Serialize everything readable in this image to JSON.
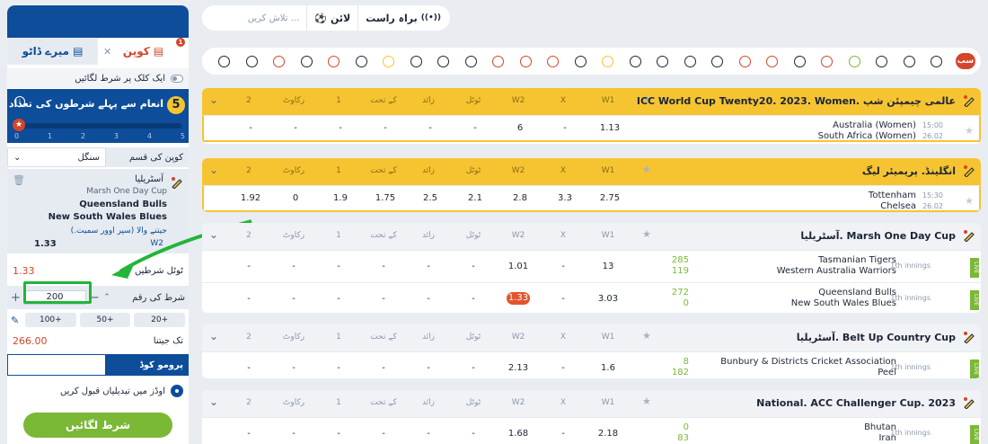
{
  "coupon": {
    "tab_coupon": "کوپن",
    "tab_coupon_count": "1",
    "tab_mydata": "میرے ڈاٹو",
    "one_click": "ایک کلک پر شرط لگائیں",
    "bonus_title": "انعام سے پہلے شرطوں کی تعداد",
    "bonus_count": "5",
    "bonus_ticks": [
      "0",
      "1",
      "2",
      "3",
      "4",
      "5"
    ],
    "bonus_progress": 0,
    "coupon_type_label": "کوپن کی قسم",
    "coupon_type_value": "سنگل",
    "bet": {
      "country": "آسٹریلیا",
      "league": "Marsh One Day Cup",
      "team1": "Queensland Bulls",
      "team2": "New South Wales Blues",
      "market": "جیتنے والا (سپر اوور سمیت.)",
      "pick": "W2",
      "odds": "1.33"
    },
    "total_odds_label": "ٹوٹل شرطیں",
    "total_odds": "1.33",
    "stake_label": "شرط کی رقم",
    "stake_value": "200",
    "quick": [
      "20+",
      "50+",
      "100+"
    ],
    "win_label": "تک جیتنا",
    "win_value": "266.00",
    "promo_label": "پرومو کوڈ",
    "accept_label": "اوڈز میں تبدیلیاں قبول کریں",
    "place_bet": "شرط لگائیں"
  },
  "search": {
    "live_label": "براہ راست",
    "line_label": "لائن",
    "placeholder": "تلاش کریں ..."
  },
  "sports_all": "سب",
  "columns": [
    "W1",
    "X",
    "W2",
    "ٹوٹل",
    "زائد",
    "کے تحت",
    "1",
    "رکاوٹ",
    "2"
  ],
  "leagues": [
    {
      "name": "ICC World Cup Twenty20. 2023. Women. عالمی چیمپئن شپ",
      "style": "yellow",
      "matches": [
        {
          "team1": "Australia (Women)",
          "team2": "South Africa (Women)",
          "time": "15:00",
          "date": "26.02",
          "odds": [
            "1.13",
            "-",
            "6",
            "-",
            "-",
            "-",
            "-",
            "-",
            "-"
          ]
        }
      ]
    },
    {
      "name": "انگلینڈ. پریمیئر لیگ",
      "style": "yellow",
      "matches": [
        {
          "team1": "Tottenham",
          "team2": "Chelsea",
          "time": "15:30",
          "date": "26.02",
          "odds": [
            "2.75",
            "3.3",
            "2.8",
            "2.1",
            "2.5",
            "1.75",
            "1.9",
            "0",
            "1.92"
          ]
        }
      ]
    },
    {
      "name": "آسٹریلیا. Marsh One Day Cup",
      "style": "grey",
      "matches": [
        {
          "team1": "Tasmanian Tigers",
          "team2": "Western Australia Warriors",
          "inning": "1th innings",
          "live": "LIVE",
          "score1": "285",
          "score2": "119",
          "odds": [
            "13",
            "-",
            "1.01",
            "-",
            "-",
            "-",
            "-",
            "-",
            "-"
          ]
        },
        {
          "team1": "Queensland Bulls",
          "team2": "New South Wales Blues",
          "inning": "1th innings",
          "live": "LIVE",
          "score1": "272",
          "score2": "0",
          "odds": [
            "3.03",
            "-",
            "1.33",
            "-",
            "-",
            "-",
            "-",
            "-",
            "-"
          ]
        }
      ]
    },
    {
      "name": "آسٹریلیا. Belt Up Country Cup",
      "style": "grey",
      "matches": [
        {
          "team1": "Bunbury & Districts Cricket Association",
          "team2": "Peel",
          "inning": "1th innings",
          "live": "LIVE",
          "score1": "8",
          "score2": "182",
          "odds": [
            "1.6",
            "-",
            "2.13",
            "-",
            "-",
            "-",
            "-",
            "-",
            "-"
          ]
        }
      ]
    },
    {
      "name": "National. ACC Challenger Cup. 2023",
      "style": "grey",
      "matches": [
        {
          "team1": "Bhutan",
          "team2": "Iran",
          "inning": "1th innings",
          "live": "LIVE",
          "score1": "0",
          "score2": "83",
          "odds": [
            "2.18",
            "-",
            "1.68",
            "-",
            "-",
            "-",
            "-",
            "-",
            "-"
          ]
        }
      ]
    }
  ]
}
